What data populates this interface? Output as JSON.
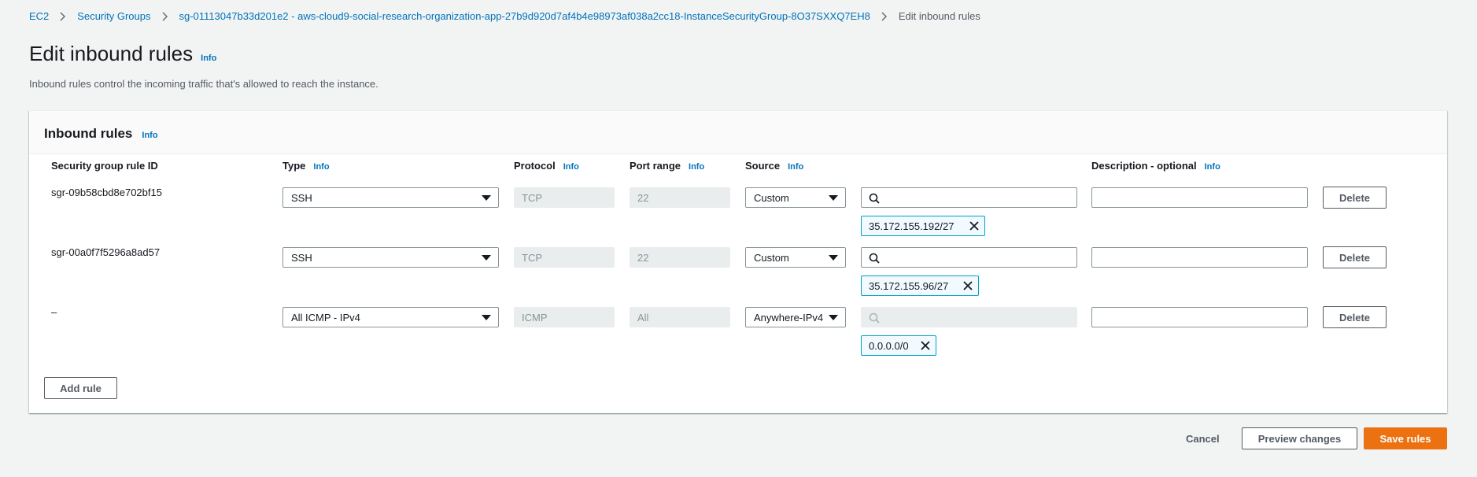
{
  "breadcrumb": {
    "items": [
      "EC2",
      "Security Groups",
      "sg-01113047b33d201e2 - aws-cloud9-social-research-organization-app-27b9d920d7af4b4e98973af038a2cc18-InstanceSecurityGroup-8O37SXXQ7EH8"
    ],
    "current": "Edit inbound rules"
  },
  "page": {
    "title": "Edit inbound rules",
    "info": "Info",
    "description": "Inbound rules control the incoming traffic that's allowed to reach the instance."
  },
  "panel": {
    "title": "Inbound rules",
    "info": "Info",
    "columns": {
      "rule_id": "Security group rule ID",
      "type": "Type",
      "protocol": "Protocol",
      "port_range": "Port range",
      "source": "Source",
      "description": "Description - optional",
      "info": "Info"
    },
    "rows": [
      {
        "rule_id": "sgr-09b58cbd8e702bf15",
        "type": "SSH",
        "protocol": "TCP",
        "port": "22",
        "source": "Custom",
        "token": "35.172.155.192/27",
        "delete": "Delete"
      },
      {
        "rule_id": "sgr-00a0f7f5296a8ad57",
        "type": "SSH",
        "protocol": "TCP",
        "port": "22",
        "source": "Custom",
        "token": "35.172.155.96/27",
        "delete": "Delete"
      },
      {
        "rule_id": "–",
        "type": "All ICMP - IPv4",
        "protocol": "ICMP",
        "port": "All",
        "source": "Anywhere-IPv4",
        "token": "0.0.0.0/0",
        "delete": "Delete"
      }
    ],
    "add_rule": "Add rule"
  },
  "footer": {
    "cancel": "Cancel",
    "preview": "Preview changes",
    "save": "Save rules"
  },
  "colors": {
    "link": "#0073bb",
    "primary": "#ec7211",
    "token_border": "#00a1c9",
    "background": "#f2f3f3"
  }
}
